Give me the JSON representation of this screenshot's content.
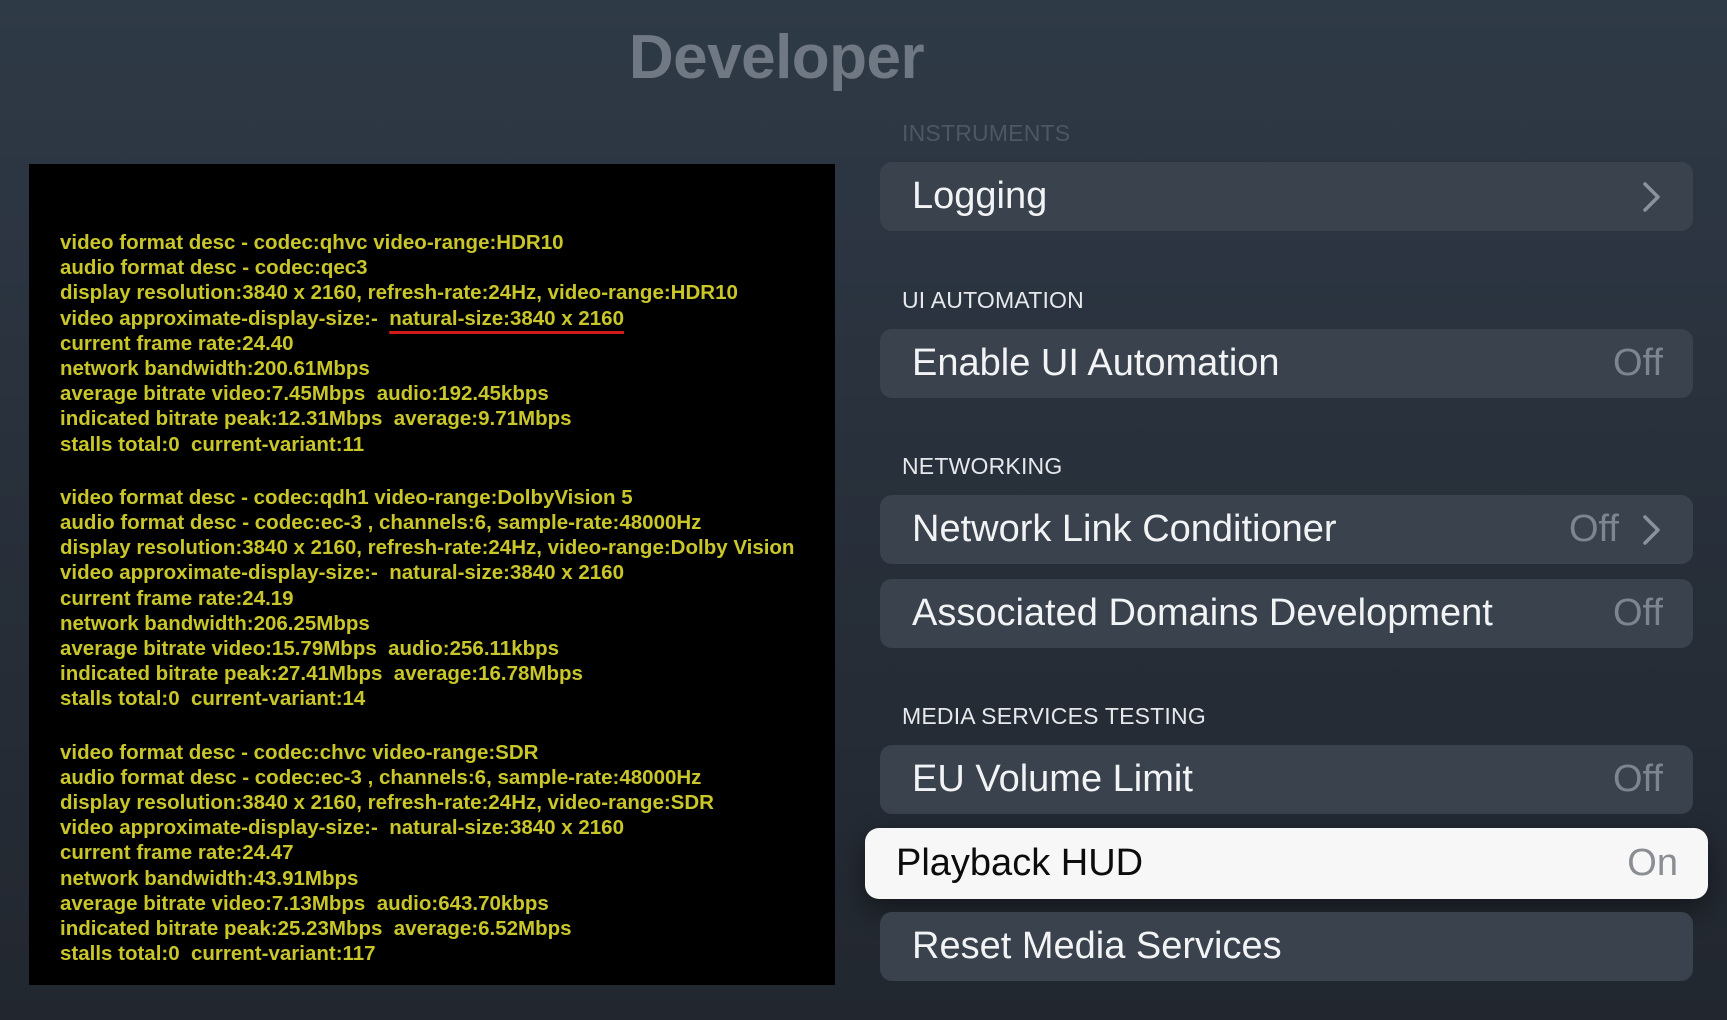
{
  "page": {
    "title": "Developer"
  },
  "hud": {
    "groups": [
      {
        "lines": [
          "video format desc - codec:qhvc video-range:HDR10",
          "audio format desc - codec:qec3",
          "display resolution:3840 x 2160, refresh-rate:24Hz, video-range:HDR10",
          "video approximate-display-size:-  ",
          "current frame rate:24.40",
          "network bandwidth:200.61Mbps",
          "average bitrate video:7.45Mbps  audio:192.45kbps",
          "indicated bitrate peak:12.31Mbps  average:9.71Mbps",
          "stalls total:0  current-variant:11"
        ],
        "underlined_suffix": "natural-size:3840 x 2160"
      },
      {
        "lines": [
          "video format desc - codec:qdh1 video-range:DolbyVision 5",
          "audio format desc - codec:ec-3 , channels:6, sample-rate:48000Hz",
          "display resolution:3840 x 2160, refresh-rate:24Hz, video-range:Dolby Vision",
          "video approximate-display-size:-  natural-size:3840 x 2160",
          "current frame rate:24.19",
          "network bandwidth:206.25Mbps",
          "average bitrate video:15.79Mbps  audio:256.11kbps",
          "indicated bitrate peak:27.41Mbps  average:16.78Mbps",
          "stalls total:0  current-variant:14"
        ]
      },
      {
        "lines": [
          "video format desc - codec:chvc video-range:SDR",
          "audio format desc - codec:ec-3 , channels:6, sample-rate:48000Hz",
          "display resolution:3840 x 2160, refresh-rate:24Hz, video-range:SDR",
          "video approximate-display-size:-  natural-size:3840 x 2160",
          "current frame rate:24.47",
          "network bandwidth:43.91Mbps",
          "average bitrate video:7.13Mbps  audio:643.70kbps",
          "indicated bitrate peak:25.23Mbps  average:6.52Mbps",
          "stalls total:0  current-variant:117"
        ]
      }
    ],
    "colors": {
      "text": "#c9c62a",
      "underline": "#d11a1a",
      "background": "#000000"
    }
  },
  "settings": {
    "sections": {
      "instruments": "INSTRUMENTS",
      "ui_automation": "UI AUTOMATION",
      "networking": "NETWORKING",
      "media_services_testing": "MEDIA SERVICES TESTING"
    },
    "rows": {
      "logging": {
        "label": "Logging",
        "icon": "chevron-right-icon"
      },
      "enable_ui_automation": {
        "label": "Enable UI Automation",
        "value": "Off"
      },
      "network_link_conditioner": {
        "label": "Network Link Conditioner",
        "value": "Off",
        "icon": "chevron-right-icon"
      },
      "associated_domains_development": {
        "label": "Associated Domains Development",
        "value": "Off"
      },
      "eu_volume_limit": {
        "label": "EU Volume Limit",
        "value": "Off"
      },
      "playback_hud": {
        "label": "Playback HUD",
        "value": "On",
        "focused": true
      },
      "reset_media_services": {
        "label": "Reset Media Services"
      }
    }
  }
}
